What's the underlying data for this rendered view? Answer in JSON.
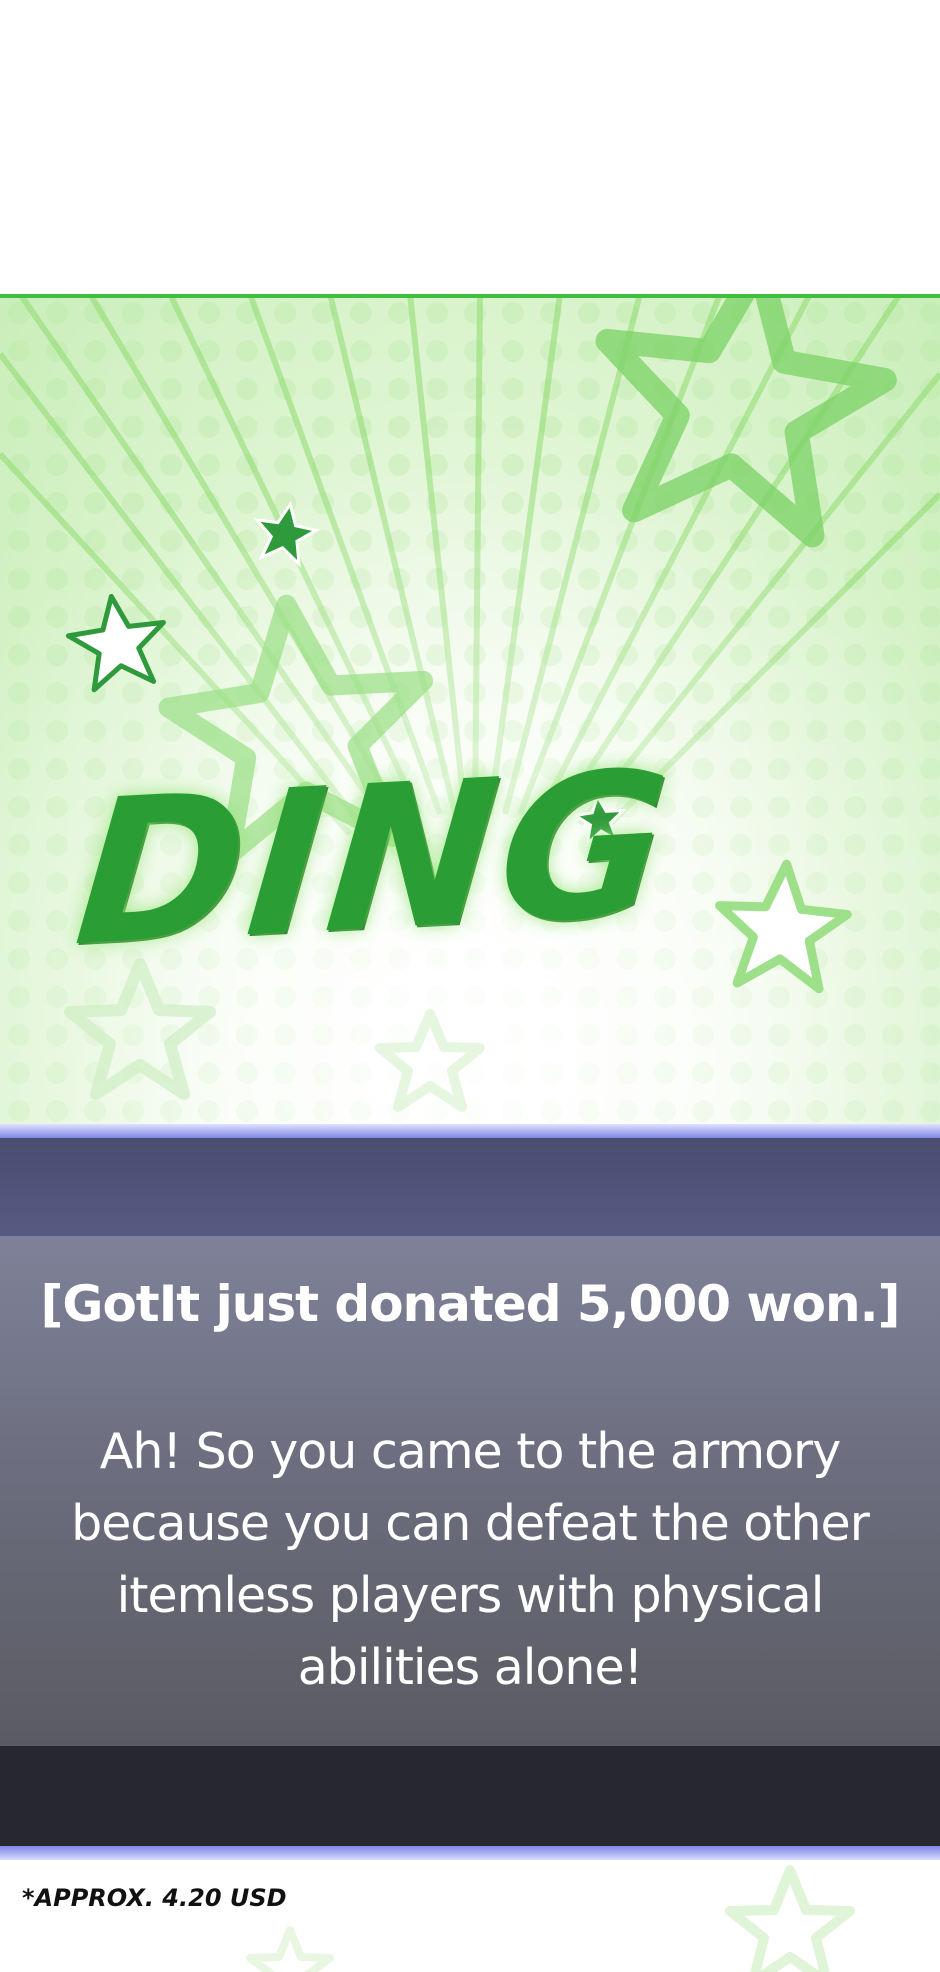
{
  "panel": {
    "sound_effect": "DING",
    "colors": {
      "sfx_fill": "#2a9d34",
      "star_dark": "#2f9a3c",
      "star_light": "#7fd36a",
      "background_light": "#dff5d3"
    },
    "icons": [
      "star-icon",
      "star-outline-icon"
    ]
  },
  "dialog": {
    "donation": "[GotIt just donated 5,000 won.]",
    "message": "Ah! So you came to the armory because you can defeat the other itemless players with physical abilities alone!",
    "colors": {
      "header": "#4a4c70",
      "body": "#6a6c7c",
      "footer": "#272730",
      "glow": "#7f86e6"
    }
  },
  "footnote": "*APPROX. 4.20 USD"
}
